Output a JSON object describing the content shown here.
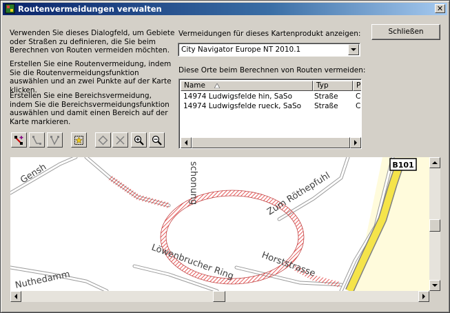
{
  "window": {
    "title": "Routenvermeidungen verwalten",
    "close_glyph": "✕"
  },
  "instructions": [
    "Verwenden Sie dieses Dialogfeld, um Gebiete oder Straßen zu definieren, die Sie beim Berechnen von Routen vermeiden möchten.",
    "Erstellen Sie eine Routenvermeidung, indem Sie die Routenvermeidungsfunktion auswählen und an zwei Punkte auf der Karte klicken.",
    "Erstellen Sie eine Bereichsvermeidung, indem Sie die Bereichsvermeidungsfunktion auswählen und damit einen Bereich auf der Karte markieren."
  ],
  "close_button": "Schließen",
  "map_product": {
    "label": "Vermeidungen für dieses Kartenprodukt anzeigen:",
    "selected": "City Navigator Europe NT 2010.1"
  },
  "avoidances": {
    "label": "Diese Orte beim Berechnen von Routen vermeiden:",
    "columns": [
      "Name",
      "Typ",
      "P"
    ],
    "rows": [
      {
        "name": "14974 Ludwigsfelde hin, SaSo",
        "type": "Straße",
        "p": "C"
      },
      {
        "name": "14974 Ludwigsfelde rueck, SaSo",
        "type": "Straße",
        "p": "C"
      }
    ]
  },
  "toolbar": {
    "icons": [
      "route-avoid-add-icon",
      "route-avoid-edit-icon",
      "route-avoid-split-icon",
      "area-avoid-icon",
      "select-icon",
      "delete-icon",
      "zoom-in-icon",
      "zoom-out-icon"
    ]
  },
  "map": {
    "road_labels": [
      "Gensh",
      "schonung",
      "Zum Röthepfuhl",
      "Löwenbrucher Ring",
      "Horststrasse",
      "Nuthedamm"
    ],
    "shield": "B101"
  }
}
